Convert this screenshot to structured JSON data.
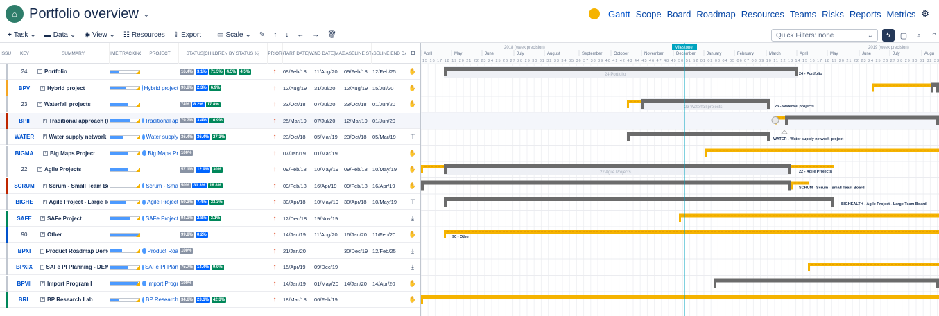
{
  "header": {
    "title": "Portfolio overview",
    "logo_icon": "portfolio-logo-icon"
  },
  "nav": {
    "items": [
      "Gantt",
      "Scope",
      "Board",
      "Roadmap",
      "Resources",
      "Teams",
      "Risks",
      "Reports",
      "Metrics"
    ]
  },
  "toolbar": {
    "task": "Task",
    "data": "Data",
    "view": "View",
    "resources": "Resources",
    "export": "Export",
    "scale": "Scale",
    "quick_filters": "Quick Filters: none"
  },
  "columns": {
    "issue": "ISSU",
    "key": "KEY",
    "summary": "SUMMARY",
    "time_tracking": "TIME TRACKING",
    "project": "PROJECT",
    "status": "STATUS[CHILDREN BY STATUS %]",
    "priority": "PRIOR",
    "start_date": "START DATE[WI",
    "end_date": "END DATE[MAX",
    "baseline_start": "BASELINE ST",
    "baseline_end": "BASELINE END DAT"
  },
  "rows": [
    {
      "key": "24",
      "summary": "Portfolio",
      "project": "",
      "status": [
        "16.4%",
        "3.1%",
        "71.5%",
        "4.5%",
        "4.5%"
      ],
      "start": "09/Feb/18",
      "end": "11/Aug/20",
      "bstart": "09/Feb/18",
      "bend": "12/Feb/25",
      "stripe": "#c1c7d0",
      "tool": "hand"
    },
    {
      "key": "BPV",
      "summary": "Hybrid project",
      "project": "Hybrid project",
      "status": [
        "90.8%",
        "2.3%",
        "6.9%"
      ],
      "start": "12/Aug/19",
      "end": "31/Jul/20",
      "bstart": "12/Aug/19",
      "bend": "15/Jul/20",
      "stripe": "#f5a623",
      "tool": "hand"
    },
    {
      "key": "23",
      "summary": "Waterfall projects",
      "project": "",
      "status": [
        "74%",
        "8.2%",
        "17.8%"
      ],
      "start": "23/Oct/18",
      "end": "07/Jul/20",
      "bstart": "23/Oct/18",
      "bend": "01/Jun/20",
      "stripe": "#c1c7d0",
      "tool": "hand"
    },
    {
      "key": "BPII",
      "summary": "Traditional approach (Wa",
      "project": "Traditional ap",
      "status": [
        "79.7%",
        "3.4%",
        "16.9%"
      ],
      "start": "25/Mar/19",
      "end": "07/Jul/20",
      "bstart": "12/Mar/19",
      "bend": "01/Jun/20",
      "stripe": "#bf2600",
      "tool": "more"
    },
    {
      "key": "WATER",
      "summary": "Water supply network pr",
      "project": "Water supply",
      "status": [
        "36.4%",
        "36.4%",
        "27.3%"
      ],
      "start": "23/Oct/18",
      "end": "05/Mar/19",
      "bstart": "23/Oct/18",
      "bend": "05/Mar/19",
      "stripe": "#c1c7d0",
      "tool": "pin"
    },
    {
      "key": "BIGMA",
      "summary": "Big Maps Project",
      "project": "Big Maps Pr",
      "status": [
        "100%"
      ],
      "start": "07/Jan/19",
      "end": "01/Mar/19",
      "bstart": "",
      "bend": "",
      "stripe": "#c1c7d0",
      "tool": "hand"
    },
    {
      "key": "22",
      "summary": "Agile Projects",
      "project": "",
      "status": [
        "57.1%",
        "12.9%",
        "30%"
      ],
      "start": "09/Feb/18",
      "end": "10/May/19",
      "bstart": "09/Feb/18",
      "bend": "10/May/19",
      "stripe": "#c1c7d0",
      "tool": "hand"
    },
    {
      "key": "SCRUM",
      "summary": "Scrum - Small Team Boa",
      "project": "Scrum - Sma",
      "status": [
        "50%",
        "31.3%",
        "18.8%"
      ],
      "start": "09/Feb/18",
      "end": "16/Apr/19",
      "bstart": "09/Feb/18",
      "bend": "16/Apr/19",
      "stripe": "#bf2600",
      "tool": "hand"
    },
    {
      "key": "BIGHE",
      "summary": "Agile Project - Large Tea",
      "project": "Agile Project",
      "status": [
        "59.3%",
        "7.4%",
        "33.3%"
      ],
      "start": "30/Apr/18",
      "end": "10/May/19",
      "bstart": "30/Apr/18",
      "bend": "10/May/19",
      "stripe": "#c1c7d0",
      "tool": "pin"
    },
    {
      "key": "SAFE",
      "summary": "SAFe Project",
      "project": "SAFe Project",
      "status": [
        "94.1%",
        "2.8%",
        "3.1%"
      ],
      "start": "12/Dec/18",
      "end": "19/Nov/19",
      "bstart": "",
      "bend": "",
      "stripe": "#00875a",
      "tool": "down"
    },
    {
      "key": "90",
      "summary": "Other",
      "project": "",
      "status": [
        "99.8%",
        "0.2%"
      ],
      "start": "14/Jan/19",
      "end": "11/Aug/20",
      "bstart": "16/Jan/20",
      "bend": "11/Feb/20",
      "stripe": "#0052cc",
      "tool": "hand"
    },
    {
      "key": "BPXI",
      "summary": "Product Roadmap Demo",
      "project": "Product Roa",
      "status": [
        "100%"
      ],
      "start": "21/Jan/20",
      "end": "",
      "bstart": "30/Dec/19",
      "bend": "12/Feb/25",
      "stripe": "#c1c7d0",
      "tool": "down"
    },
    {
      "key": "BPXIX",
      "summary": "SAFe PI Planning - DEMO",
      "project": "SAFe PI Plan",
      "status": [
        "75.7%",
        "14.4%",
        "9.9%"
      ],
      "start": "15/Apr/19",
      "end": "09/Dec/19",
      "bstart": "",
      "bend": "",
      "stripe": "#c1c7d0",
      "tool": "down"
    },
    {
      "key": "BPVII",
      "summary": "Import Program I",
      "project": "Import Progr",
      "status": [
        "100%"
      ],
      "start": "14/Jan/19",
      "end": "01/May/20",
      "bstart": "14/Jan/20",
      "bend": "14/Apr/20",
      "stripe": "#c1c7d0",
      "tool": "hand"
    },
    {
      "key": "BRL",
      "summary": "BP Research Lab",
      "project": "BP Research",
      "status": [
        "34.6%",
        "23.1%",
        "42.3%"
      ],
      "start": "18/Mar/18",
      "end": "06/Feb/19",
      "bstart": "",
      "bend": "",
      "stripe": "#00875a",
      "tool": "hand"
    }
  ],
  "gantt": {
    "years": [
      "2018 (week precision)",
      "2019 (week precision)"
    ],
    "months": [
      "April",
      "May",
      "June",
      "July",
      "August",
      "September",
      "October",
      "November",
      "December",
      "January",
      "February",
      "March",
      "April",
      "May",
      "June",
      "July",
      "Augu"
    ],
    "weeks": "15 16 17 18 19 20 21 22 23 24 25 26 27 28 29 30 31 32 33 34 35 36 37 38 39 40 41 42 43 44 45 46 47 48 49 50 51 52 01 02 03 04 05 06 07 08 09 10 11 12 13 14 15 16 17 18 19 20 21 22 23 24 25 26 27 28 29 30 31 32 33",
    "milestone": "Milestone",
    "labels": [
      "24 Portfolio",
      "24 - Portfolio",
      "23 Waterfall projects",
      "23 - Waterfall projects",
      "WATER - Water supply network project",
      "22 Agile Projects",
      "22 - Agile Projects",
      "SCRUM - Scrum - Small Team Board",
      "BIGHEALTH - Agile Project - Large Team Board",
      "90 - Other"
    ]
  },
  "colors": {
    "yellow": "#f5b300",
    "bar": "#6b6b6b",
    "milestone": "#00a3bf"
  }
}
